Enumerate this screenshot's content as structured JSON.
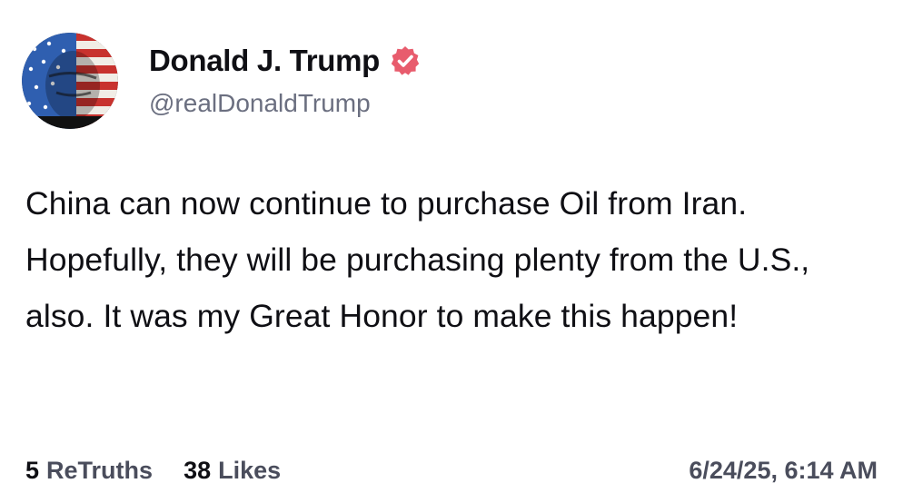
{
  "post": {
    "author": {
      "display_name": "Donald J. Trump",
      "handle": "@realDonaldTrump",
      "verified_icon": "verified-badge-icon",
      "avatar": "avatar-image"
    },
    "text": "China can now continue to purchase Oil from Iran. Hopefully, they will be purchasing plenty from the U.S., also. It was my Great Honor to make this happen!",
    "stats": {
      "retruths_count": "5",
      "retruths_label": "ReTruths",
      "likes_count": "38",
      "likes_label": "Likes"
    },
    "timestamp": "6/24/25, 6:14 AM"
  },
  "colors": {
    "verified_badge": "#e85c6d",
    "text_primary": "#0f0f14",
    "text_secondary": "#6b6f80",
    "stat_label": "#4a4d5c"
  }
}
